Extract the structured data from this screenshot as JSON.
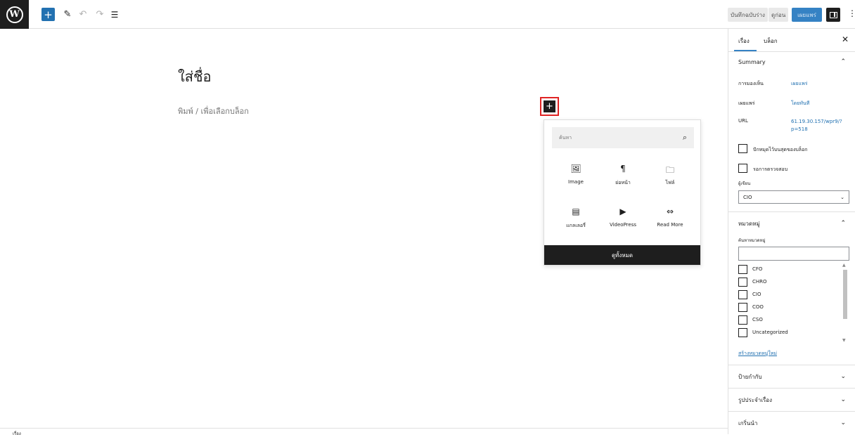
{
  "topbar": {
    "add_block": "+",
    "edit_tool": "✎",
    "undo": "↶",
    "redo": "↷",
    "outline": "☰",
    "save_draft": "บันทึกฉบับร่าง",
    "preview": "ดูก่อน",
    "publish": "เผยแพร่",
    "menu": "⋮",
    "accent": "#2271b1"
  },
  "editor": {
    "title": "ใส่ชื่อ",
    "placeholder": "พิมพ์ / เพื่อเลือกบล็อก",
    "inserter": "+"
  },
  "inserter_popover": {
    "search_placeholder": "ค้นหา",
    "search_icon": "⌕",
    "blocks": [
      {
        "label": "Image",
        "icon": "🖼"
      },
      {
        "label": "ย่อหน้า",
        "icon": "¶"
      },
      {
        "label": "ไฟล์",
        "icon": "🗀"
      },
      {
        "label": "แกลเลอรี่",
        "icon": "▤"
      },
      {
        "label": "VideoPress",
        "icon": "▶"
      },
      {
        "label": "Read More",
        "icon": "⇔"
      }
    ],
    "browse_all": "ดูทั้งหมด"
  },
  "statusbar": {
    "label": "เรื่อง"
  },
  "sidebar": {
    "tabs": {
      "document": "เรื่อง",
      "block": "บล็อก",
      "close": "✕"
    },
    "summary": {
      "title": "Summary",
      "chevron": "⌃",
      "visibility_label": "การมองเห็น",
      "visibility_value": "เผยแพร่",
      "publish_label": "เผยแพร่",
      "publish_value": "โดยทันที",
      "url_label": "URL",
      "url_value": "61.19.30.157/wpr9/?p=518",
      "stick_top": "ปักหมุดไว้บนสุดของบล็อก",
      "pending_review": "รอการตรวจสอบ",
      "author_label": "ผู้เขียน",
      "author_value": "CIO",
      "select_chevron": "⌄"
    },
    "categories": {
      "title": "หมวดหมู่",
      "chevron": "⌃",
      "search_label": "ค้นหาหมวดหมู่",
      "items": [
        "CFO",
        "CHRO",
        "CIO",
        "COO",
        "CSO",
        "Uncategorized"
      ],
      "add_new": "สร้างหมวดหมู่ใหม่"
    },
    "collapsed_panels": [
      {
        "title": "ป้ายกำกับ",
        "chevron": "⌄"
      },
      {
        "title": "รูปประจำเรื่อง",
        "chevron": "⌄"
      },
      {
        "title": "เกริ่นนำ",
        "chevron": "⌄"
      }
    ]
  }
}
